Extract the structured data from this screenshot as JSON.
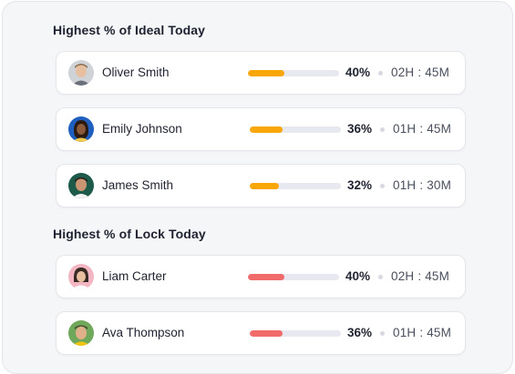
{
  "sections": [
    {
      "title": "Highest % of Ideal Today",
      "bar_color": "#f9a608",
      "rows": [
        {
          "name": "Oliver Smith",
          "percent": "40%",
          "progress": 0.4,
          "time": "02H : 45M",
          "avatar": "avatar-oliver"
        },
        {
          "name": "Emily Johnson",
          "percent": "36%",
          "progress": 0.36,
          "time": "01H : 45M",
          "avatar": "avatar-emily"
        },
        {
          "name": "James Smith",
          "percent": "32%",
          "progress": 0.32,
          "time": "01H : 30M",
          "avatar": "avatar-james"
        }
      ]
    },
    {
      "title": "Highest % of Lock Today",
      "bar_color": "#f26b6b",
      "rows": [
        {
          "name": "Liam Carter",
          "percent": "40%",
          "progress": 0.4,
          "time": "02H : 45M",
          "avatar": "avatar-liam"
        },
        {
          "name": "Ava Thompson",
          "percent": "36%",
          "progress": 0.36,
          "time": "01H : 45M",
          "avatar": "avatar-ava"
        }
      ]
    }
  ],
  "colors": {
    "track": "#e8e8f0",
    "text": "#1f2230",
    "muted": "#4a4f5e"
  }
}
